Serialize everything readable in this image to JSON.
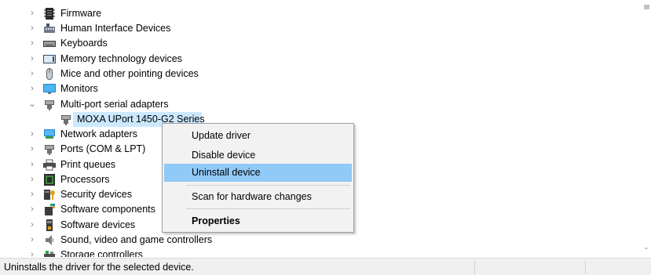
{
  "tree": {
    "items": [
      {
        "label": "Firmware",
        "icon": "firmware-icon",
        "expander": "›"
      },
      {
        "label": "Human Interface Devices",
        "icon": "hid-icon",
        "expander": "›"
      },
      {
        "label": "Keyboards",
        "icon": "keyboard-icon",
        "expander": "›"
      },
      {
        "label": "Memory technology devices",
        "icon": "memory-card-icon",
        "expander": "›"
      },
      {
        "label": "Mice and other pointing devices",
        "icon": "mouse-icon",
        "expander": "›"
      },
      {
        "label": "Monitors",
        "icon": "monitor-icon",
        "expander": "›"
      },
      {
        "label": "Multi-port serial adapters",
        "icon": "serial-port-icon",
        "expander": "⌄"
      },
      {
        "label": "MOXA UPort 1450-G2 Series",
        "icon": "serial-port-icon"
      },
      {
        "label": "Network adapters",
        "icon": "network-adapter-icon",
        "expander": "›"
      },
      {
        "label": "Ports (COM & LPT)",
        "icon": "serial-port-icon",
        "expander": "›"
      },
      {
        "label": "Print queues",
        "icon": "printer-icon",
        "expander": "›"
      },
      {
        "label": "Processors",
        "icon": "processor-icon",
        "expander": "›"
      },
      {
        "label": "Security devices",
        "icon": "security-device-icon",
        "expander": "›"
      },
      {
        "label": "Software components",
        "icon": "software-component-icon",
        "expander": "›"
      },
      {
        "label": "Software devices",
        "icon": "software-device-icon",
        "expander": "›"
      },
      {
        "label": "Sound, video and game controllers",
        "icon": "speaker-icon",
        "expander": "›"
      },
      {
        "label": "Storage controllers",
        "icon": "storage-controller-icon",
        "expander": "›"
      }
    ]
  },
  "context_menu": {
    "items": [
      {
        "label": "Update driver"
      },
      {
        "label": "Disable device"
      },
      {
        "label": "Uninstall device"
      },
      {
        "label": "Scan for hardware changes"
      },
      {
        "label": "Properties"
      }
    ]
  },
  "status_bar": {
    "text": "Uninstalls the driver for the selected device."
  },
  "colors": {
    "selection": "#cce8ff",
    "menu_highlight": "#91c9f7",
    "menu_background": "#f2f2f2"
  }
}
